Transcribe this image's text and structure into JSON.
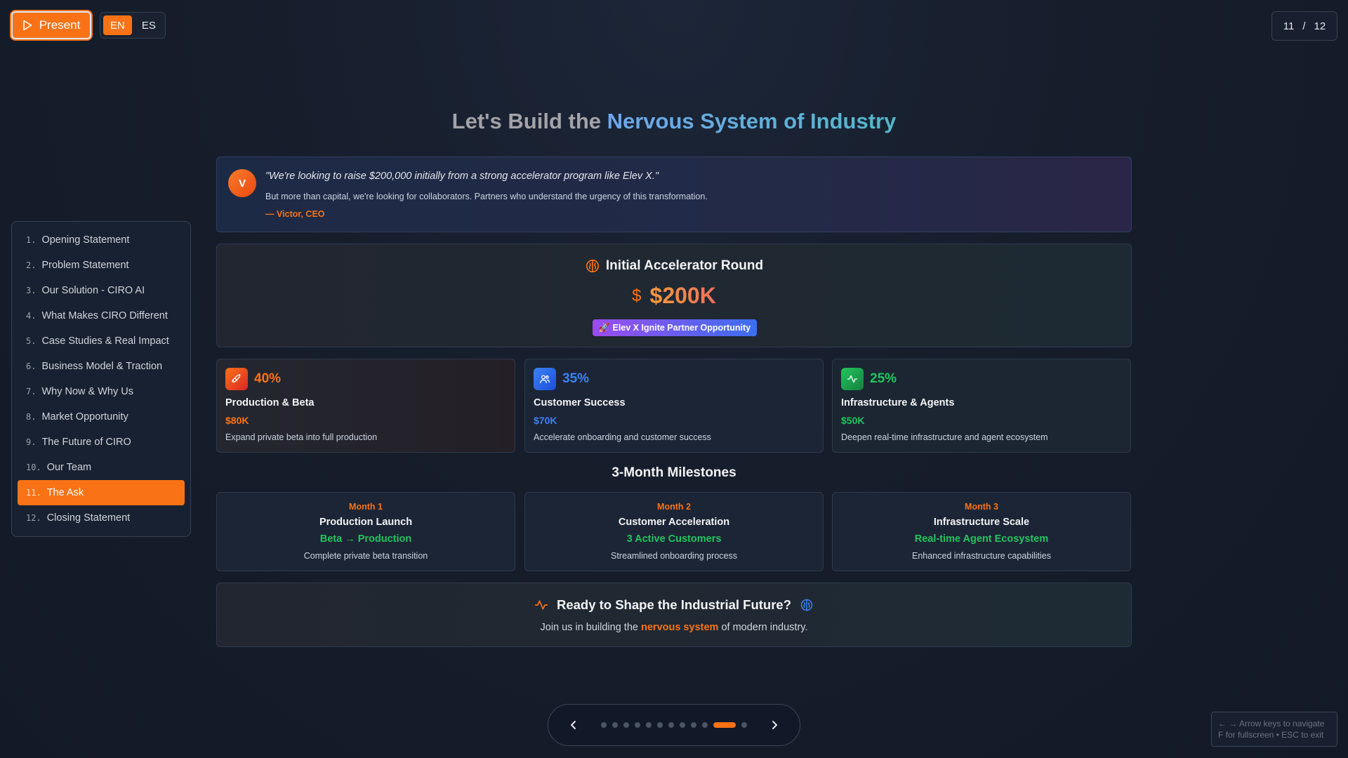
{
  "toolbar": {
    "present_label": "Present",
    "lang_en": "EN",
    "lang_es": "ES"
  },
  "counter": {
    "current": "11",
    "sep": "/",
    "total": "12"
  },
  "sidebar": {
    "items": [
      {
        "num": "1.",
        "label": "Opening Statement"
      },
      {
        "num": "2.",
        "label": "Problem Statement"
      },
      {
        "num": "3.",
        "label": "Our Solution - CIRO AI"
      },
      {
        "num": "4.",
        "label": "What Makes CIRO Different"
      },
      {
        "num": "5.",
        "label": "Case Studies & Real Impact"
      },
      {
        "num": "6.",
        "label": "Business Model & Traction"
      },
      {
        "num": "7.",
        "label": "Why Now & Why Us"
      },
      {
        "num": "8.",
        "label": "Market Opportunity"
      },
      {
        "num": "9.",
        "label": "The Future of CIRO"
      },
      {
        "num": "10.",
        "label": "Our Team"
      },
      {
        "num": "11.",
        "label": "The Ask"
      },
      {
        "num": "12.",
        "label": "Closing Statement"
      }
    ],
    "active_index": 10
  },
  "slide": {
    "title_a": "Let's Build the ",
    "title_b": "Nervous System of Industry",
    "quote": {
      "avatar": "V",
      "text": "\"We're looking to raise $200,000 initially from a strong accelerator program like Elev X.\"",
      "sub": "But more than capital, we're looking for collaborators. Partners who understand the urgency of this transformation.",
      "author": "— Victor, CEO"
    },
    "round": {
      "icon": "brain-icon",
      "title": "Initial Accelerator Round",
      "dollar": "$",
      "amount": "$200K",
      "badge_icon": "🚀",
      "badge": "Elev X Ignite Partner Opportunity"
    },
    "allocations": [
      {
        "icon": "rocket-icon",
        "pct": "40%",
        "name": "Production & Beta",
        "amount": "$80K",
        "desc": "Expand private beta into full production",
        "color": "#f97316",
        "icon_bg": "#ea580c"
      },
      {
        "icon": "users-icon",
        "pct": "35%",
        "name": "Customer Success",
        "amount": "$70K",
        "desc": "Accelerate onboarding and customer success",
        "color": "#3b82f6",
        "icon_bg": "#2563eb"
      },
      {
        "icon": "activity-icon",
        "pct": "25%",
        "name": "Infrastructure & Agents",
        "amount": "$50K",
        "desc": "Deepen real-time infrastructure and agent ecosystem",
        "color": "#22c55e",
        "icon_bg": "#16a34a"
      }
    ],
    "milestones_title": "3-Month Milestones",
    "milestones": [
      {
        "month": "Month 1",
        "title": "Production Launch",
        "goal": "Beta → Production",
        "desc": "Complete private beta transition"
      },
      {
        "month": "Month 2",
        "title": "Customer Acceleration",
        "goal": "3 Active Customers",
        "desc": "Streamlined onboarding process"
      },
      {
        "month": "Month 3",
        "title": "Infrastructure Scale",
        "goal": "Real-time Agent Ecosystem",
        "desc": "Enhanced infrastructure capabilities"
      }
    ],
    "cta": {
      "title": "Ready to Shape the Industrial Future?",
      "text_a": "Join us in building the ",
      "text_hl": "nervous system",
      "text_b": " of modern industry."
    }
  },
  "nav": {
    "dot_count": 12,
    "active_dot": 10
  },
  "help": {
    "line1": "← → Arrow keys to navigate",
    "line2": "F for fullscreen • ESC to exit"
  },
  "colors": {
    "accent": "#f97316",
    "background": "#161d2b"
  }
}
